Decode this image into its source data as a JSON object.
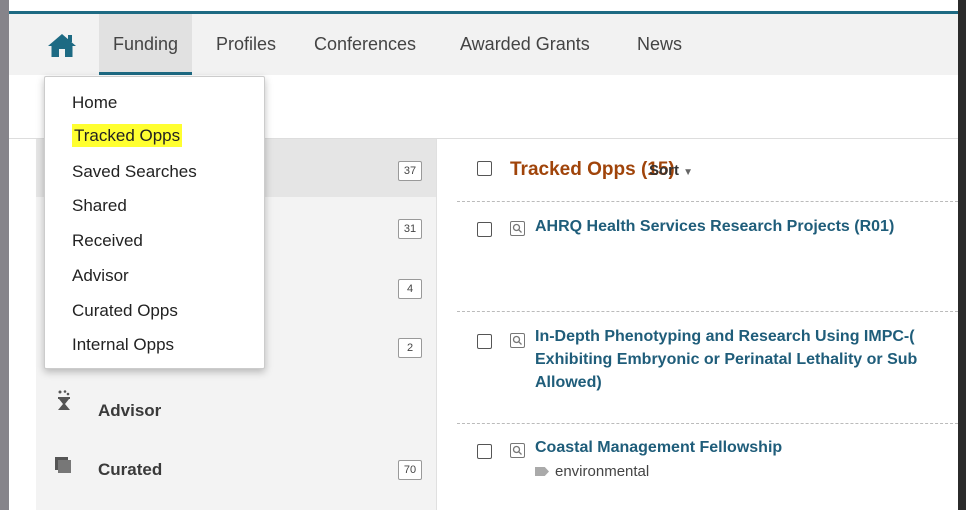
{
  "nav": {
    "items": [
      "Funding",
      "Profiles",
      "Conferences",
      "Awarded Grants",
      "News"
    ],
    "active": "Funding"
  },
  "dropdown": {
    "items": [
      "Home",
      "Tracked Opps",
      "Saved Searches",
      "Shared",
      "Received",
      "Advisor",
      "Curated Opps",
      "Internal Opps"
    ],
    "highlighted": "Tracked Opps",
    "highlight_color": "#ffff30"
  },
  "sidebar": {
    "items": [
      {
        "label": "",
        "count": "37"
      },
      {
        "label": "",
        "count": "31"
      },
      {
        "label": "",
        "count": "4"
      },
      {
        "label": "",
        "count": "2"
      },
      {
        "label": "Advisor",
        "count": "",
        "icon": "advisor-icon"
      },
      {
        "label": "Curated",
        "count": "70",
        "icon": "curated-icon"
      }
    ]
  },
  "main": {
    "title": "Tracked Opps (15)",
    "sort_label": "Sort",
    "opportunities": [
      {
        "title_lines": [
          "AHRQ Health Services Research Projects (R01)"
        ],
        "tag": ""
      },
      {
        "title_lines": [
          "In-Depth Phenotyping and Research Using IMPC-(",
          "Exhibiting Embryonic or Perinatal Lethality or Sub",
          "Allowed)"
        ],
        "tag": ""
      },
      {
        "title_lines": [
          "Coastal Management Fellowship"
        ],
        "tag": "environmental"
      }
    ]
  },
  "colors": {
    "accent": "#1d6a83",
    "title": "#a0440a",
    "link": "#1f5d7a"
  }
}
